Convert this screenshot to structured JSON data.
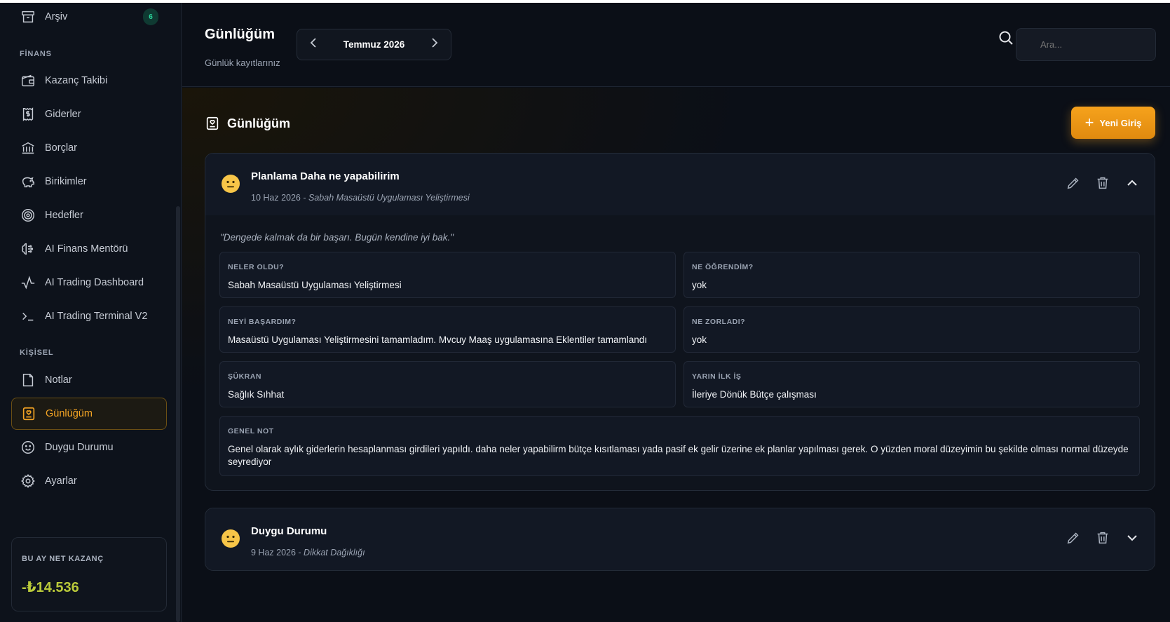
{
  "sidebar": {
    "items_top": [
      {
        "label": "Arşiv",
        "badge": "6"
      }
    ],
    "section_finans": "FİNANS",
    "finans_items": [
      {
        "label": "Kazanç Takibi"
      },
      {
        "label": "Giderler"
      },
      {
        "label": "Borçlar"
      },
      {
        "label": "Birikimler"
      },
      {
        "label": "Hedefler"
      },
      {
        "label": "AI Finans Mentörü"
      },
      {
        "label": "AI Trading Dashboard"
      },
      {
        "label": "AI Trading Terminal V2"
      }
    ],
    "section_kisisel": "KİŞİSEL",
    "kisisel_items": [
      {
        "label": "Notlar"
      },
      {
        "label": "Günlüğüm",
        "active": true
      },
      {
        "label": "Duygu Durumu"
      },
      {
        "label": "Ayarlar"
      }
    ],
    "net_card": {
      "label": "BU AY NET KAZANÇ",
      "value": "-₺14.536"
    }
  },
  "header": {
    "title": "Günlüğüm",
    "subtitle": "Günlük kayıtlarınız",
    "month": "Temmuz 2026",
    "search_placeholder": "Ara..."
  },
  "main": {
    "section_title": "Günlüğüm",
    "new_button": "Yeni Giriş",
    "entries": [
      {
        "title": "Planlama Daha ne yapabilirim",
        "date": "10 Haz 2026",
        "tag": "Sabah Masaüstü Uygulaması Yeliştirmesi",
        "quote": "\"Dengede kalmak da bir başarı. Bugün kendine iyi bak.\"",
        "fields": {
          "neler_oldu": {
            "label": "NELER OLDU?",
            "value": "Sabah Masaüstü Uygulaması Yeliştirmesi"
          },
          "ne_ogrendim": {
            "label": "NE ÖĞRENDİM?",
            "value": "yok"
          },
          "neyi_basardim": {
            "label": "NEYİ BAŞARDIM?",
            "value": "Masaüstü Uygulaması Yeliştirmesini tamamladım. Mvcuy Maaş uygulamasına Eklentiler tamamlandı"
          },
          "ne_zorladi": {
            "label": "NE ZORLADI?",
            "value": "yok"
          },
          "sukran": {
            "label": "ŞÜKRAN",
            "value": "Sağlık Sıhhat"
          },
          "yarin_ilk_is": {
            "label": "YARIN İLK İŞ",
            "value": "İleriye Dönük Bütçe çalışması"
          },
          "genel_not": {
            "label": "GENEL NOT",
            "value": "Genel olarak aylık giderlerin hesaplanması girdileri yapıldı. daha neler yapabilirm bütçe kısıtlaması yada pasif ek gelir üzerine ek planlar yapılması gerek. O yüzden moral düzeyimin bu şekilde olması normal düzeyde seyrediyor"
          }
        }
      },
      {
        "title": "Duygu Durumu",
        "date": "9 Haz 2026",
        "tag": "Dikkat Dağıklığı"
      }
    ]
  },
  "colors": {
    "accent": "#f5a524",
    "net_value": "#b9c93a",
    "badge": "#2bd49b"
  }
}
